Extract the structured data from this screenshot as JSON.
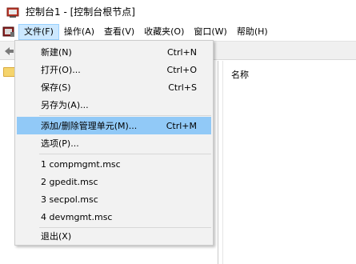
{
  "window": {
    "title": "控制台1 - [控制台根节点]"
  },
  "menubar": {
    "items": [
      {
        "label": "文件(F)",
        "active": true
      },
      {
        "label": "操作(A)"
      },
      {
        "label": "查看(V)"
      },
      {
        "label": "收藏夹(O)"
      },
      {
        "label": "窗口(W)"
      },
      {
        "label": "帮助(H)"
      }
    ]
  },
  "right_pane": {
    "column_header": "名称"
  },
  "file_menu": {
    "items": [
      {
        "label": "新建(N)",
        "accel": "Ctrl+N"
      },
      {
        "label": "打开(O)...",
        "accel": "Ctrl+O"
      },
      {
        "label": "保存(S)",
        "accel": "Ctrl+S"
      },
      {
        "label": "另存为(A)...",
        "accel": ""
      },
      {
        "label": "添加/删除管理单元(M)...",
        "accel": "Ctrl+M",
        "highlighted": true
      },
      {
        "label": "选项(P)...",
        "accel": ""
      },
      {
        "label": "1 compmgmt.msc",
        "accel": ""
      },
      {
        "label": "2 gpedit.msc",
        "accel": ""
      },
      {
        "label": "3 secpol.msc",
        "accel": ""
      },
      {
        "label": "4 devmgmt.msc",
        "accel": ""
      },
      {
        "label": "退出(X)",
        "accel": ""
      }
    ]
  },
  "colors": {
    "highlight": "#91c9f7",
    "menu_active": "#cce8ff",
    "dropdown_bg": "#f2f2f2"
  }
}
